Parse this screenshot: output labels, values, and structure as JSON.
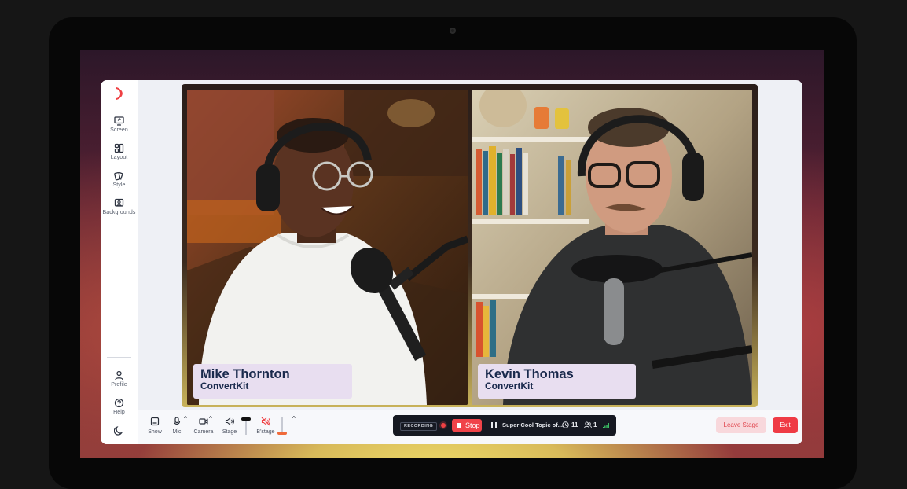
{
  "sidebar": {
    "items": [
      {
        "label": "Screen",
        "icon": "screen-share-icon"
      },
      {
        "label": "Layout",
        "icon": "layout-icon"
      },
      {
        "label": "Style",
        "icon": "style-icon"
      },
      {
        "label": "Backgrounds",
        "icon": "backgrounds-icon"
      }
    ],
    "bottom_items": [
      {
        "label": "Profile",
        "icon": "profile-icon"
      },
      {
        "label": "Help",
        "icon": "help-icon"
      }
    ],
    "theme_icon": "moon-icon"
  },
  "stage": {
    "participants": [
      {
        "name": "Mike Thornton",
        "company": "ConvertKit"
      },
      {
        "name": "Kevin Thomas",
        "company": "ConvertKit"
      }
    ]
  },
  "toolbar": {
    "show_label": "Show",
    "mic_label": "Mic",
    "camera_label": "Camera",
    "stage_label": "Stage",
    "bstage_label": "B'stage",
    "recording": {
      "badge": "RECORDING",
      "stop_label": "Stop",
      "topic": "Super Cool Topic of...",
      "timer": "11",
      "viewers": "1"
    },
    "leave_label": "Leave Stage",
    "exit_label": "Exit"
  },
  "colors": {
    "accent": "#ef4144",
    "nameplate": "#e8def0",
    "nameplate_text": "#1a2a4d",
    "recbar": "#161922",
    "leave_bg": "#f8d8dc"
  }
}
